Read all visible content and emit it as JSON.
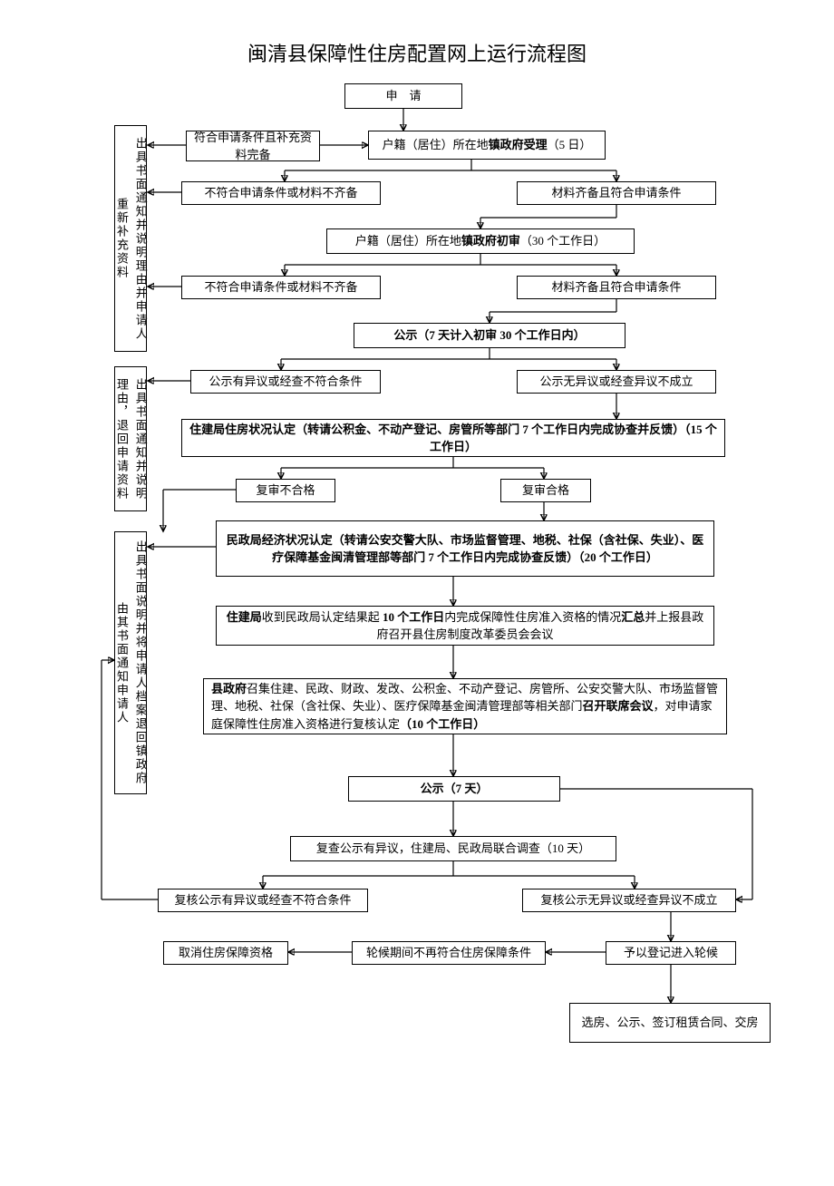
{
  "title": "闽清县保障性住房配置网上运行流程图",
  "nodes": {
    "start": "申　请",
    "side1": "出具书面通知并说明理由并申请人重新补充资料",
    "side2": "出具书面通知并说明理由，退回申请资料",
    "side3": "出具书面说明并将申请人档案退回镇政府由其书面通知申请人",
    "a1": "符合申请条件且补充资料完备",
    "b1": "户籍（居住）所在地镇政府受理（5 日）",
    "c1": "不符合申请条件或材料不齐备",
    "d1": "材料齐备且符合申请条件",
    "e1": "户籍（居住）所在地镇政府初审（30 个工作日）",
    "c2": "不符合申请条件或材料不齐备",
    "d2": "材料齐备且符合申请条件",
    "f1": "公示（7 天计入初审 30 个工作日内）",
    "g1": "公示有异议或经查不符合条件",
    "g2": "公示无异议或经查异议不成立",
    "h1": "住建局住房状况认定（转请公积金、不动产登记、房管所等部门 7 个工作日内完成协查并反馈）（15 个工作日）",
    "i1": "复审不合格",
    "i2": "复审合格",
    "j1": "民政局经济状况认定（转请公安交警大队、市场监督管理、地税、社保（含社保、失业）、医疗保障基金闽清管理部等部门 7 个工作日内完成协查反馈）（20 个工作日）",
    "k1": "住建局收到民政局认定结果起 10 个工作日内完成保障性住房准入资格的情况汇总并上报县政府召开县住房制度改革委员会会议",
    "l1": "县政府召集住建、民政、财政、发改、公积金、不动产登记、房管所、公安交警大队、市场监督管理、地税、社保（含社保、失业）、医疗保障基金闽清管理部等相关部门召开联席会议，对申请家庭保障性住房准入资格进行复核认定（10 个工作日）",
    "m1": "公示（7 天）",
    "n1": "复查公示有异议，住建局、民政局联合调查（10 天）",
    "o1": "复核公示有异议或经查不符合条件",
    "o2": "复核公示无异议或经查异议不成立",
    "p1": "取消住房保障资格",
    "p2": "轮候期间不再符合住房保障条件",
    "p3": "予以登记进入轮候",
    "q1": "选房、公示、签订租赁合同、交房"
  }
}
